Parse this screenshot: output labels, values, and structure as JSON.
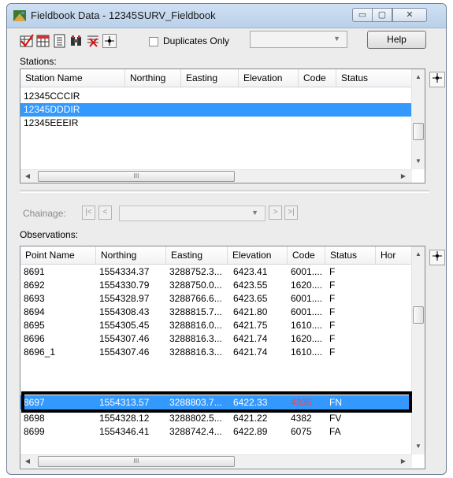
{
  "window": {
    "title": "Fieldbook Data - 12345SURV_Fieldbook",
    "caption_buttons": {
      "minimize": "▭",
      "maximize": "▢",
      "close": "✕"
    }
  },
  "toolbar": {
    "icons": [
      "check-table-icon",
      "table-icon",
      "list-icon",
      "binoculars-icon",
      "cross-edit-icon",
      "locate-icon"
    ],
    "duplicates_label": "Duplicates Only",
    "duplicates_checked": false,
    "filter_value": "",
    "help_label": "Help"
  },
  "stations": {
    "label": "Stations:",
    "columns": [
      "Station Name",
      "Northing",
      "Easting",
      "Elevation",
      "Code",
      "Status"
    ],
    "rows": [
      {
        "name": "12345CCCIR",
        "selected": false
      },
      {
        "name": "12345DDDIR",
        "selected": true
      },
      {
        "name": "12345EEEIR",
        "selected": false
      }
    ],
    "hscroll_grip": "III"
  },
  "chainage": {
    "label": "Chainage:",
    "first": "|<",
    "prev": "<",
    "next": ">",
    "last": ">|",
    "value": ""
  },
  "observations": {
    "label": "Observations:",
    "columns": [
      "Point Name",
      "Northing",
      "Easting",
      "Elevation",
      "Code",
      "Status",
      "Hor"
    ],
    "rows": [
      {
        "point": "8691",
        "northing": "1554334.37",
        "easting": "3288752.3...",
        "elevation": "6423.41",
        "code": "6001....",
        "status": "F",
        "selected": false
      },
      {
        "point": "8692",
        "northing": "1554330.79",
        "easting": "3288750.0...",
        "elevation": "6423.55",
        "code": "1620....",
        "status": "F",
        "selected": false
      },
      {
        "point": "8693",
        "northing": "1554328.97",
        "easting": "3288766.6...",
        "elevation": "6423.65",
        "code": "6001....",
        "status": "F",
        "selected": false
      },
      {
        "point": "8694",
        "northing": "1554308.43",
        "easting": "3288815.7...",
        "elevation": "6421.80",
        "code": "6001....",
        "status": "F",
        "selected": false
      },
      {
        "point": "8695",
        "northing": "1554305.45",
        "easting": "3288816.0...",
        "elevation": "6421.75",
        "code": "1610....",
        "status": "F",
        "selected": false
      },
      {
        "point": "8696",
        "northing": "1554307.46",
        "easting": "3288816.3...",
        "elevation": "6421.74",
        "code": "1620....",
        "status": "F",
        "selected": false
      },
      {
        "point": "8696_1",
        "northing": "1554307.46",
        "easting": "3288816.3...",
        "elevation": "6421.74",
        "code": "1610....",
        "status": "F",
        "selected": false
      },
      {
        "point": "8697",
        "northing": "1554313.57",
        "easting": "3288803.7...",
        "elevation": "6422.33",
        "code": "4335",
        "status": "FN",
        "selected": true
      },
      {
        "point": "8698",
        "northing": "1554328.12",
        "easting": "3288802.5...",
        "elevation": "6421.22",
        "code": "4382",
        "status": "FV",
        "selected": false
      },
      {
        "point": "8699",
        "northing": "1554346.41",
        "easting": "3288742.4...",
        "elevation": "6422.89",
        "code": "6075",
        "status": "FA",
        "selected": false
      }
    ],
    "hscroll_grip": "III"
  },
  "colors": {
    "selection": "#3399ff",
    "code_highlight": "#ff4040",
    "annotation_box": "#000000"
  }
}
